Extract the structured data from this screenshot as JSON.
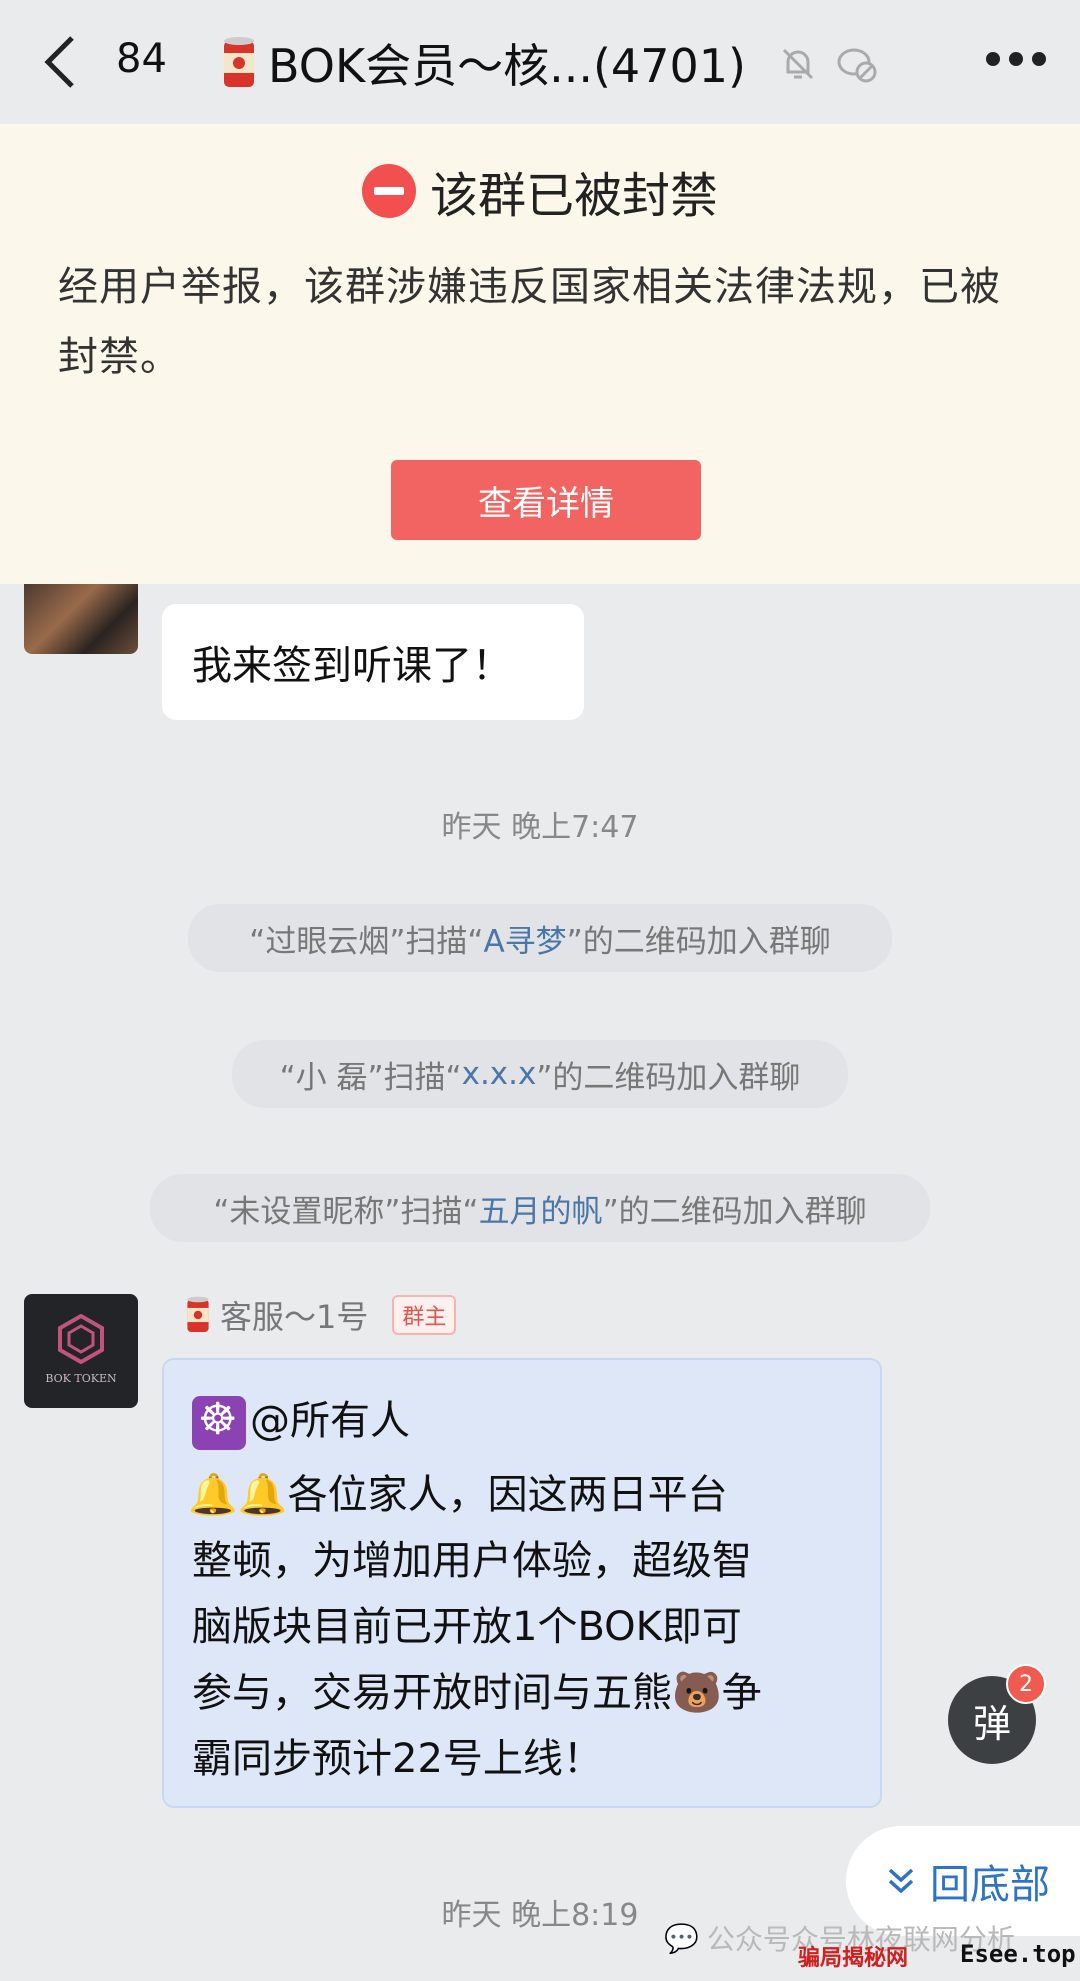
{
  "header": {
    "unread_count": "84",
    "group_title": "BOK会员～核...(4701)"
  },
  "ban_notice": {
    "title": "该群已被封禁",
    "description": "经用户举报，该群涉嫌违反国家相关法律法规，已被封禁。",
    "button_label": "查看详情"
  },
  "messages": [
    {
      "type": "text",
      "text": "我来签到听课了！"
    },
    {
      "type": "time",
      "text": "昨天 晚上7:47"
    },
    {
      "type": "system",
      "pre": "“过眼云烟”扫描“",
      "hl": "A寻梦",
      "post": "”的二维码加入群聊"
    },
    {
      "type": "system",
      "pre": "“小 磊”扫描“",
      "hl": "x.x.x",
      "post": "”的二维码加入群聊"
    },
    {
      "type": "system",
      "pre": "“未设置昵称”扫描“",
      "hl": "五月的帆",
      "post": "”的二维码加入群聊"
    },
    {
      "type": "text",
      "sender": "客服～1号",
      "role_badge": "群主",
      "avatar_text": "BOK TOKEN",
      "lines": [
        "@所有人",
        "🔔🔔各位家人，因这两日平台",
        "整顿，为增加用户体验，超级智",
        "脑版块目前已开放1个BOK即可",
        "参与，交易开放时间与五熊🐻争",
        "霸同步预计22号上线！"
      ]
    },
    {
      "type": "time",
      "text": "昨天 晚上8:19"
    }
  ],
  "floating": {
    "popup_label": "弹",
    "popup_badge": "2",
    "back_to_bottom": "回底部"
  },
  "watermark": {
    "text": "公众号众号林夜联网分析",
    "site_cn": "骗局揭秘网",
    "site": "Esee.top"
  }
}
